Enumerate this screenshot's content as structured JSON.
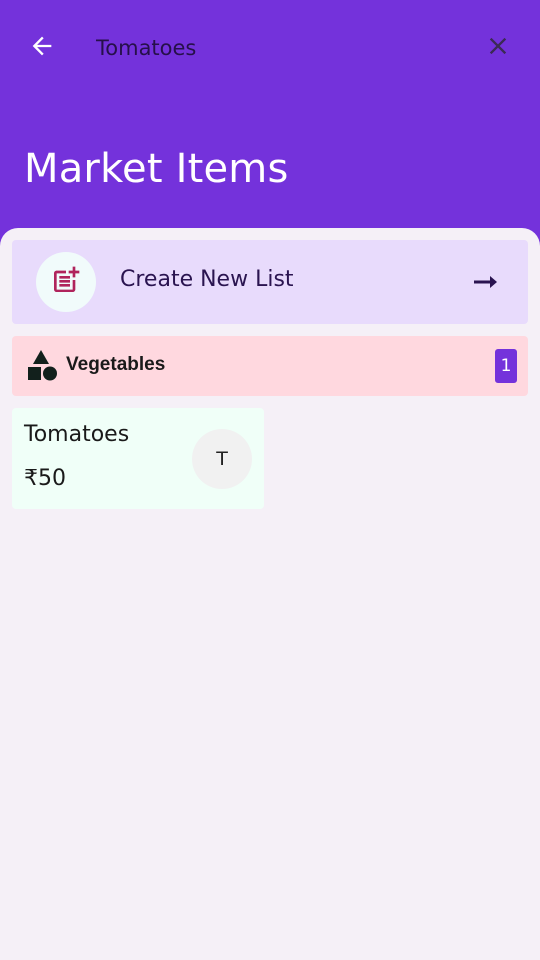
{
  "header": {
    "search_value": "Tomatoes",
    "back_icon": "arrow-left-icon",
    "close_icon": "close-icon"
  },
  "page": {
    "title": "Market Items"
  },
  "create_list": {
    "label": "Create New List",
    "icon": "post-add-icon",
    "arrow_icon": "arrow-right-icon"
  },
  "category": {
    "label": "Vegetables",
    "count": "1",
    "icon": "shapes-icon"
  },
  "items": [
    {
      "name": "Tomatoes",
      "price": "₹50",
      "avatar_letter": "T"
    }
  ],
  "colors": {
    "primary": "#7432DB",
    "create_card_bg": "#E8DBFC",
    "category_bg": "#FFD8DF",
    "item_card_bg": "#F0FFF8",
    "sheet_bg": "#F5F0F7",
    "icon_accent": "#B0245C"
  }
}
